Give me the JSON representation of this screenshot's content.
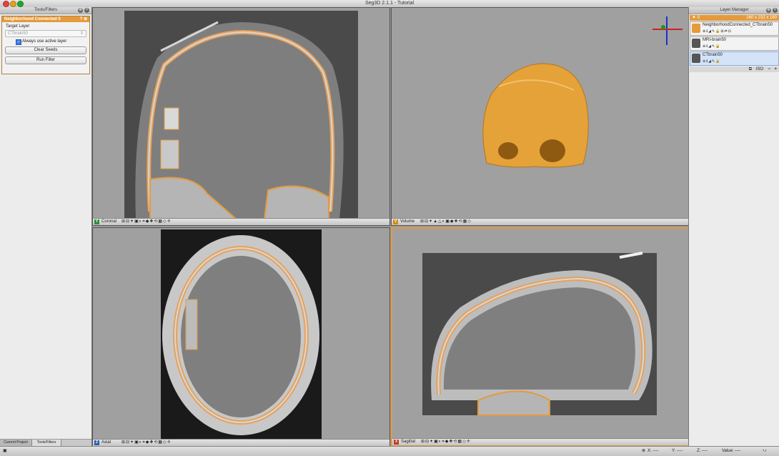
{
  "window": {
    "title": "Seg3D 2.1.1 - Tutorial"
  },
  "tools_panel": {
    "title": "Tools/Filters",
    "filter": {
      "name": "Neighborhood Connected 0",
      "help": "?",
      "target_layer_label": "Target Layer",
      "target_layer_value": "CTbrain50",
      "always_active_label": "Always use active layer",
      "clear_seeds": "Clear Seeds",
      "run_filter": "Run Filter"
    },
    "tabs": [
      "Current Project",
      "Tools/Filters"
    ]
  },
  "layer_manager": {
    "title": "Layer Manager",
    "group": {
      "name": "0",
      "dims": "160 x 232 x 160"
    },
    "layers": [
      {
        "name": "NeighborhoodConnected_CTbrain50",
        "type": "mask",
        "color": "#e59a3c"
      },
      {
        "name": "MRI-brain50",
        "type": "data",
        "color": "#555555"
      },
      {
        "name": "CTbrain50",
        "type": "data",
        "color": "#555555",
        "active": true
      }
    ],
    "footer": {
      "iso": "ISO"
    }
  },
  "viewers": [
    {
      "label": "Coronal",
      "badge": "Y",
      "badge_color": "#2f8f3a"
    },
    {
      "label": "Volume",
      "badge": "V",
      "badge_color": "#d28a1a"
    },
    {
      "label": "Axial",
      "badge": "Z",
      "badge_color": "#2a5db0"
    },
    {
      "label": "Sagittal",
      "badge": "X",
      "badge_color": "#c0392b",
      "selected": true
    }
  ],
  "status": {
    "x": "X: ----",
    "y": "Y: ----",
    "z": "Z: ----",
    "value": "Value: ----"
  }
}
